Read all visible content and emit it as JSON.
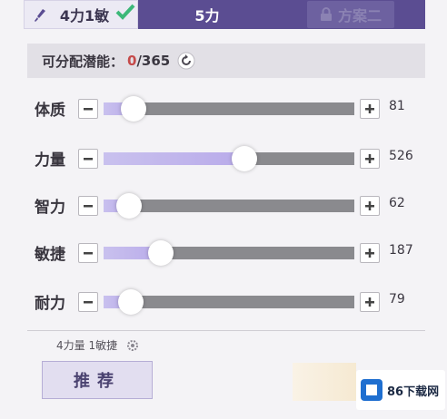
{
  "tabs": [
    {
      "label": "4力1敏",
      "state": "active"
    },
    {
      "label": "5力",
      "state": "inactive"
    },
    {
      "label": "方案二",
      "state": "locked"
    }
  ],
  "points": {
    "label": "可分配潜能：",
    "current": "0",
    "total": "/365"
  },
  "stats": [
    {
      "name": "体质",
      "value": "81",
      "fill": 0.12
    },
    {
      "name": "力量",
      "value": "526",
      "fill": 0.56
    },
    {
      "name": "智力",
      "value": "62",
      "fill": 0.1
    },
    {
      "name": "敏捷",
      "value": "187",
      "fill": 0.23
    },
    {
      "name": "耐力",
      "value": "79",
      "fill": 0.11
    }
  ],
  "preset": {
    "label": "4力量 1敏捷"
  },
  "recommend": {
    "label": "推荐"
  },
  "watermark": {
    "label": "86下载网"
  },
  "colors": {
    "accent": "#5b4d92",
    "fill": "#c2b8ee",
    "track": "#8a8a8e",
    "current_points": "#c54a4a"
  }
}
